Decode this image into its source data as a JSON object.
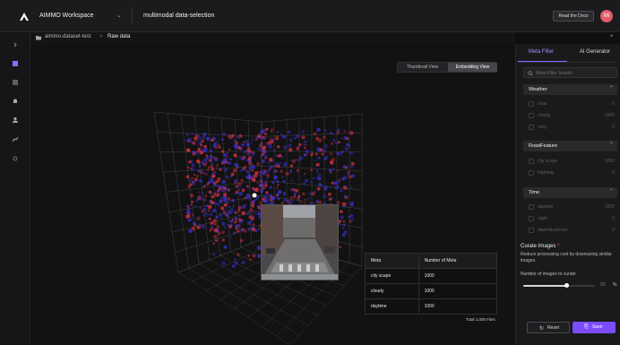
{
  "topbar": {
    "workspace": "AIMMO Workspace",
    "project": "multimodal data-selection",
    "docs_label": "Read the Docs",
    "avatar_initials": "Mi"
  },
  "breadcrumb": {
    "dataset": "aimmo-dataset-test",
    "separator": ">",
    "current": "Raw data"
  },
  "view_toggle": {
    "thumbnail": "Thumbnail View",
    "embedding": "Embedding View",
    "active": "embedding"
  },
  "meta_table": {
    "headers": [
      "Meta",
      "Number of Meta"
    ],
    "rows": [
      [
        "city scape",
        "1000"
      ],
      [
        "cloudy",
        "1000"
      ],
      [
        "daytime",
        "1000"
      ]
    ],
    "total": "Total 1,000 Files"
  },
  "panel": {
    "close": "×",
    "tabs": [
      "Meta Filter",
      "AI Generator"
    ],
    "active_tab": "Meta Filter",
    "search_placeholder": "Meta Filter Search",
    "groups": [
      {
        "title": "Weather",
        "options": [
          {
            "label": "clear",
            "count": "0"
          },
          {
            "label": "cloudy",
            "count": "1000"
          },
          {
            "label": "rainy",
            "count": "0"
          }
        ]
      },
      {
        "title": "RoadFeature",
        "options": [
          {
            "label": "city scape",
            "count": "1000"
          },
          {
            "label": "highway",
            "count": "0"
          }
        ]
      },
      {
        "title": "Time",
        "options": [
          {
            "label": "daytime",
            "count": "1000"
          },
          {
            "label": "night",
            "count": "0"
          },
          {
            "label": "dawn/dusk/sun",
            "count": "0"
          }
        ]
      }
    ],
    "curate": {
      "title": "Curate Images",
      "required_mark": "*",
      "description": "Reduce processing cost by downsizing similar images.",
      "slider_label": "Number of images to curate",
      "slider_value": "90",
      "slider_fraction": 0.6,
      "unit": "%"
    },
    "reset_label": "Reset",
    "save_label": "Save"
  },
  "colors": {
    "accent": "#7c4dff",
    "point_red": "#d0303c",
    "point_blue": "#3a30c8"
  }
}
